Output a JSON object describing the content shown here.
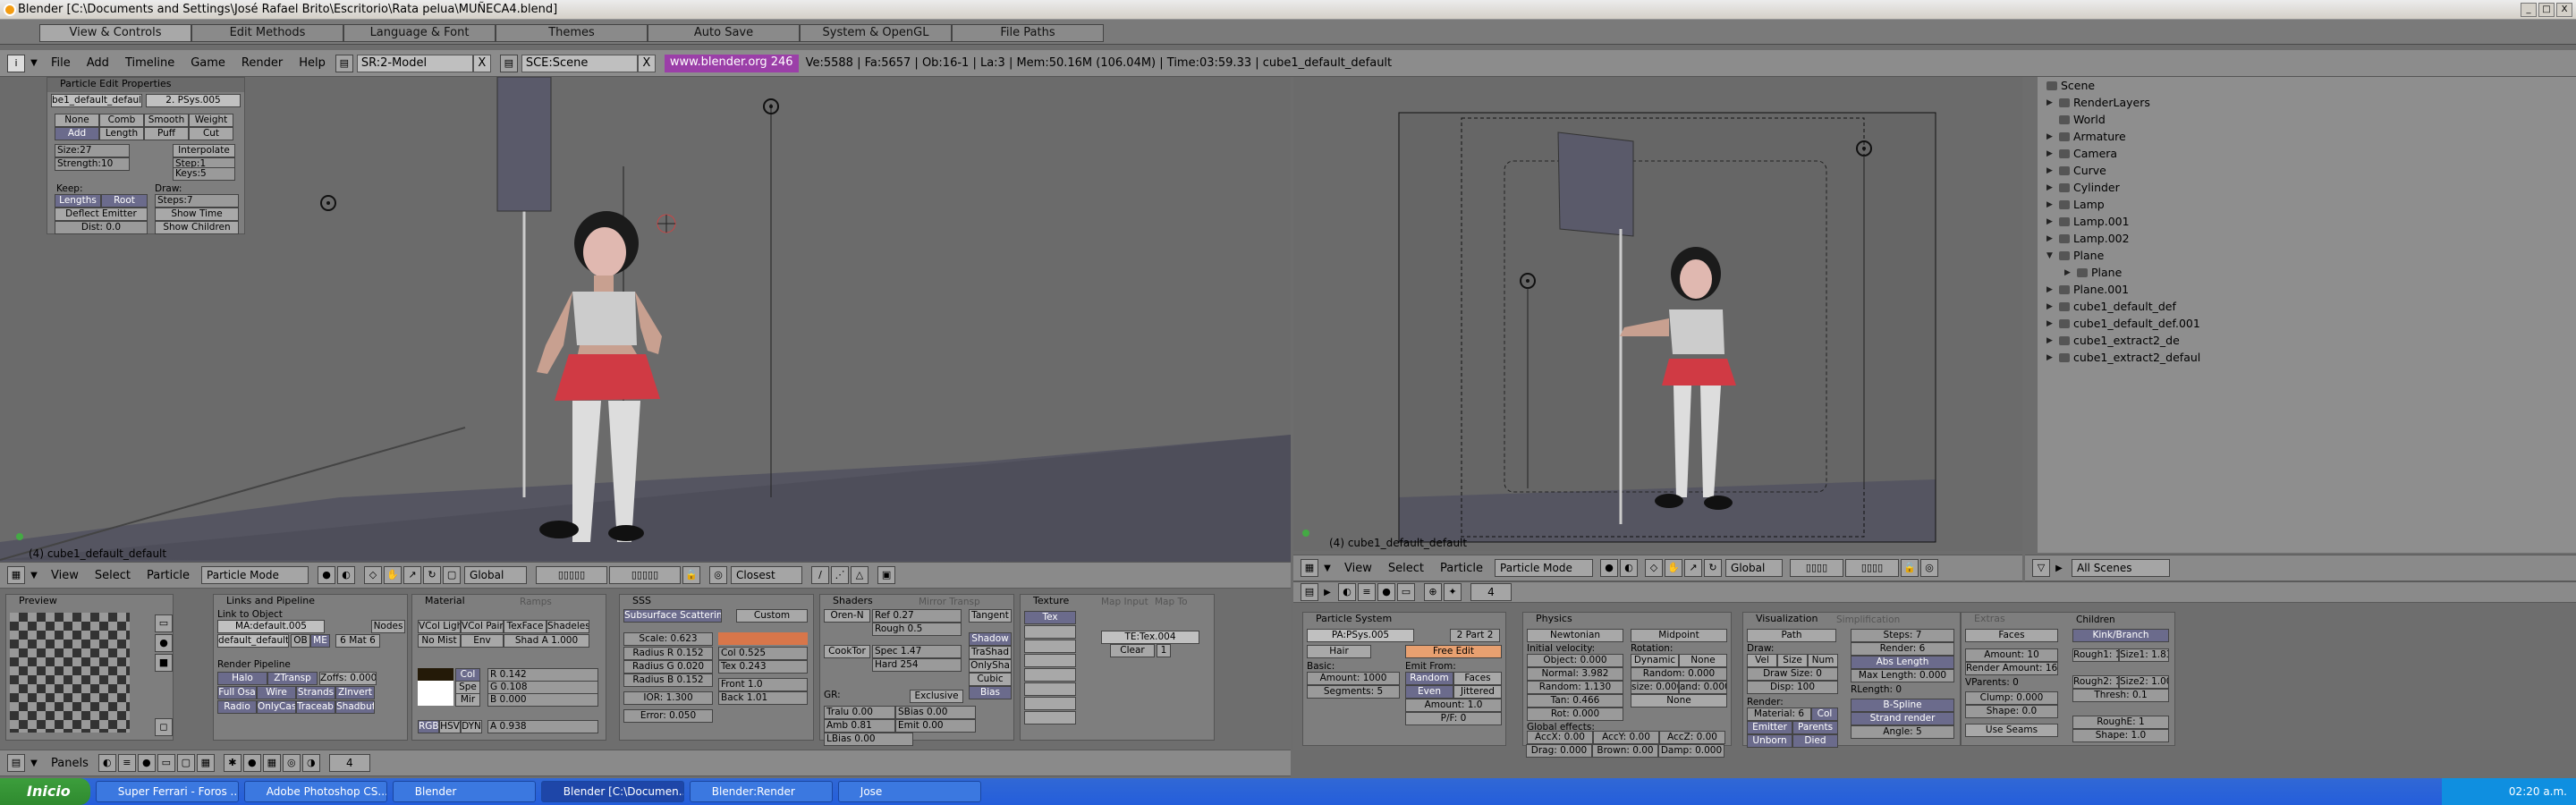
{
  "window": {
    "title": "Blender [C:\\Documents and Settings\\José Rafael Brito\\Escritorio\\Rata pelua\\MUÑECA4.blend]",
    "buttons": [
      "_",
      "□",
      "X"
    ]
  },
  "prefs": {
    "tabs": [
      "View & Controls",
      "Edit Methods",
      "Language & Font",
      "Themes",
      "Auto Save",
      "System & OpenGL",
      "File Paths"
    ]
  },
  "menu": {
    "items": [
      "File",
      "Add",
      "Timeline",
      "Game",
      "Render",
      "Help"
    ],
    "screen": "SR:2-Model",
    "scene": "SCE:Scene",
    "url": "www.blender.org 246",
    "stats": "Ve:5588 | Fa:5657 | Ob:16-1 | La:3 | Mem:50.16M (106.04M) | Time:03:59.33 | cube1_default_default"
  },
  "view1": {
    "label": "(4) cube1_default_default",
    "panel": {
      "title": "Particle Edit Properties",
      "field1": "be1_default_default",
      "field2": "2. PSys.005",
      "tools": [
        "None",
        "Comb",
        "Smooth",
        "Weight",
        "Add",
        "Length",
        "Puff",
        "Cut"
      ],
      "size": "Size:27",
      "strength": "Strength:10",
      "interp": "Interpolate",
      "step": "Step:1",
      "keys": "Keys:5",
      "keep": "Keep:",
      "draw": "Draw:",
      "lengths": "Lengths",
      "root": "Root",
      "steps": "Steps:7",
      "deflect": "Deflect Emitter",
      "showtime": "Show Time",
      "dist": "Dist: 0.0",
      "showchildren": "Show Children"
    }
  },
  "header1": {
    "menus": [
      "View",
      "Select",
      "Particle"
    ],
    "mode": "Particle Mode",
    "orient": "Global",
    "snap": "Closest"
  },
  "view2": {
    "label": "(4) cube1_default_default"
  },
  "header2": {
    "menus": [
      "View",
      "Select",
      "Particle"
    ],
    "mode": "Particle Mode",
    "orient": "Global"
  },
  "outliner": {
    "items": [
      "Scene",
      "RenderLayers",
      "World",
      "Armature",
      "Camera",
      "Curve",
      "Cylinder",
      "Lamp",
      "Lamp.001",
      "Lamp.002",
      "Plane",
      "Plane",
      "Plane.001",
      "cube1_default_def",
      "cube1_default_def.001",
      "cube1_extract2_de",
      "cube1_extract2_defaul"
    ],
    "scenes": "All Scenes"
  },
  "buttons_left": {
    "panels": "Panels",
    "frame": "4",
    "preview": "Preview",
    "links": {
      "title": "Links and Pipeline",
      "link": "Link to Object",
      "ma": "MA:default.005",
      "obj": "default_default",
      "ob": "OB",
      "me": "ME",
      "mat": "6 Mat 6",
      "nodes": "Nodes",
      "rp": "Render Pipeline",
      "halo": "Halo",
      "ztransp": "ZTransp",
      "zoffs": "Zoffs: 0.000",
      "fullosa": "Full Osa",
      "wire": "Wire",
      "strands": "Strands",
      "zinvert": "ZInvert",
      "radio": "Radio",
      "onlycast": "OnlyCast",
      "traceable": "Traceable",
      "shadbuf": "Shadbuf"
    },
    "material": {
      "title": "Material",
      "ramps": "Ramps",
      "vcol": "VCol Ligh",
      "vcolp": "VCol Pain",
      "texface": "TexFace",
      "shadeless": "Shadeles",
      "nomist": "No Mist",
      "env": "Env",
      "shad": "Shad A 1.000",
      "col": "Col",
      "spe": "Spe",
      "mir": "Mir",
      "r": "R 0.142",
      "g": "G 0.108",
      "b": "B 0.000",
      "rgb": "RGB",
      "hsv": "HSV",
      "dyn": "DYN",
      "a": "A 0.938"
    },
    "sss": {
      "title": "SSS",
      "sub": "Subsurface Scattering",
      "custom": "Custom",
      "scale": "Scale: 0.623",
      "radr": "Radius R 0.152",
      "radg": "Radius G 0.020",
      "radb": "Radius B 0.152",
      "ior": "IOR: 1.300",
      "error": "Error: 0.050",
      "colv": "Col 0.525",
      "tex": "Tex 0.243",
      "front": "Front 1.0",
      "back": "Back 1.01"
    },
    "shaders": {
      "title": "Shaders",
      "mirror": "Mirror Transp",
      "orennayar": "Oren-N",
      "ref": "Ref 0.27",
      "rough": "Rough 0.5",
      "tangent": "Tangent",
      "cooktor": "CookTor",
      "spec": "Spec 1.47",
      "hard": "Hard 254",
      "shadow": "Shadow",
      "trashad": "TraShad",
      "onlysha": "OnlySha",
      "cubic": "Cubic",
      "bias": "Bias",
      "gr": "GR:",
      "exclusive": "Exclusive",
      "tralu": "Tralu 0.00",
      "sbias": "SBias 0.00",
      "amb": "Amb 0.81",
      "emit": "Emit 0.00",
      "lbias": "LBias 0.00"
    },
    "texture": {
      "title": "Texture",
      "mapinput": "Map Input",
      "mapto": "Map To",
      "tex": "Tex",
      "te": "TE:Tex.004",
      "clear": "Clear",
      "n": "1"
    }
  },
  "buttons_right": {
    "psys": {
      "title": "Particle System",
      "pa": "PA:PSys.005",
      "part": "2 Part 2",
      "hair": "Hair",
      "basic": "Basic:",
      "amount": "Amount: 1000",
      "segments": "Segments: 5",
      "emitfrom": "Emit From:",
      "freeedit": "Free Edit",
      "random": "Random",
      "faces": "Faces",
      "even": "Even",
      "jittered": "Jittered",
      "amount2": "Amount: 1.0",
      "pf": "P/F: 0"
    },
    "physics": {
      "title": "Physics",
      "newtonian": "Newtonian",
      "initvel": "Initial velocity:",
      "object": "Object: 0.000",
      "normal": "Normal: 3.982",
      "random": "Random: 1.130",
      "tan": "Tan: 0.466",
      "rot": "Rot: 0.000",
      "global": "Global effects:",
      "accx": "AccX: 0.00",
      "accy": "AccY: 0.00",
      "accz": "AccZ: 0.00",
      "drag": "Drag: 0.000",
      "brown": "Brown: 0.00",
      "damp": "Damp: 0.000",
      "midpoint": "Midpoint",
      "rotation": "Rotation:",
      "dynamic": "Dynamic",
      "none": "None",
      "random2": "Random: 0.000",
      "size": "size: 0.000",
      "and": "and: 0.000",
      "none2": "None"
    },
    "vis": {
      "title": "Visualization",
      "simpl": "Simplification",
      "path": "Path",
      "draw": "Draw:",
      "vel": "Vel",
      "sizeb": "Size",
      "num": "Num",
      "drawsize": "Draw Size: 0",
      "disp": "Disp: 100",
      "render": "Render:",
      "material": "Material: 6",
      "col": "Col",
      "emitter": "Emitter",
      "parents": "Parents",
      "unborn": "Unborn",
      "died": "Died",
      "steps": "Steps: 7",
      "render2": "Render: 6",
      "abslength": "Abs Length",
      "maxlen": "Max Length: 0.000",
      "rlength": "RLength: 0",
      "bspline": "B-Spline",
      "strand": "Strand render",
      "angle": "Angle: 5"
    },
    "extras": {
      "title": "Extras",
      "children": "Children",
      "faces": "Faces",
      "kink": "Kink/Branch",
      "amount": "Amount: 10",
      "rendamt": "Render Amount: 16",
      "vparents": "VParents: 0",
      "clump": "Clump: 0.000",
      "shape": "Shape: 0.0",
      "seams": "Use Seams",
      "rough1": "Rough1: 1",
      "size1": "Size1: 1.839",
      "rough2": "Rough2: 1",
      "size2": "Size2: 1.000",
      "thresh": "Thresh: 0.1",
      "roughe": "RoughE: 1",
      "shape1": "Shape: 1.0"
    }
  },
  "taskbar": {
    "start": "Inicio",
    "tasks": [
      "Super Ferrari - Foros ...",
      "Adobe Photoshop CS...",
      "Blender",
      "Blender [C:\\Documen...",
      "Blender:Render",
      "Jose"
    ],
    "clock": "02:20 a.m."
  }
}
